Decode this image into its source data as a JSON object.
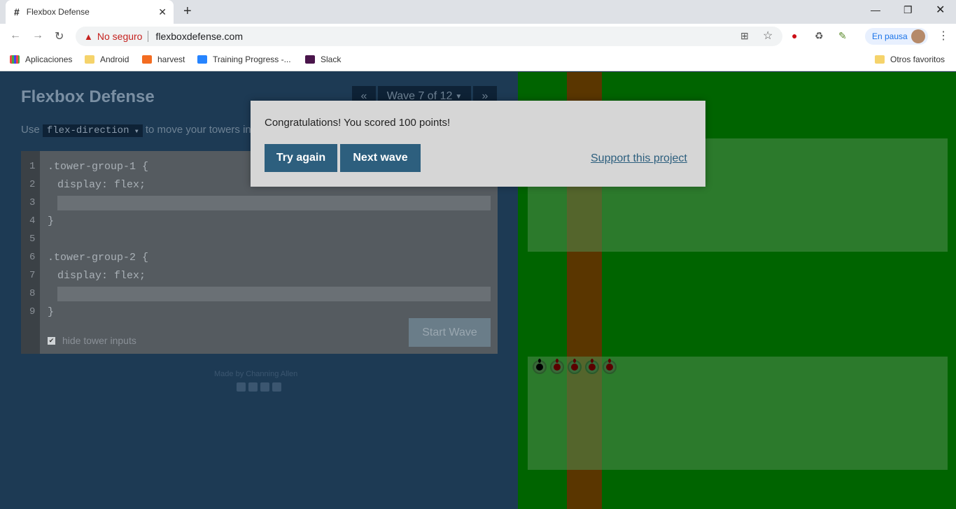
{
  "browser": {
    "tab_title": "Flexbox Defense",
    "favicon_glyph": "#",
    "security_label": "No seguro",
    "url": "flexboxdefense.com",
    "profile_status": "En pausa",
    "bookmarks": [
      "Aplicaciones",
      "Android",
      "harvest",
      "Training Progress -...",
      "Slack"
    ],
    "other_bookmarks": "Otros favoritos"
  },
  "game": {
    "title": "Flexbox Defense",
    "wave_label": "Wave 7 of 12",
    "prev_wave": "«",
    "next_wave": "»",
    "instruction_prefix": "Use",
    "instruction_property": "flex-direction",
    "instruction_suffix": "to move your towers into p",
    "code_lines": [
      ".tower-group-1 {",
      "display: flex;",
      "",
      "}",
      "",
      ".tower-group-2 {",
      "display: flex;",
      "",
      "}"
    ],
    "line_numbers": [
      "1",
      "2",
      "3",
      "4",
      "5",
      "6",
      "7",
      "8",
      "9"
    ],
    "start_wave": "Start Wave",
    "hide_inputs": "hide tower inputs",
    "credit": "Made by Channing Allen"
  },
  "modal": {
    "message": "Congratulations! You scored 100 points!",
    "try_again": "Try again",
    "next_wave": "Next wave",
    "support": "Support this project"
  },
  "colors": {
    "accent": "#2d5f7e",
    "grass": "#006400",
    "road": "#5a3600",
    "panel": "#1d3a54"
  }
}
